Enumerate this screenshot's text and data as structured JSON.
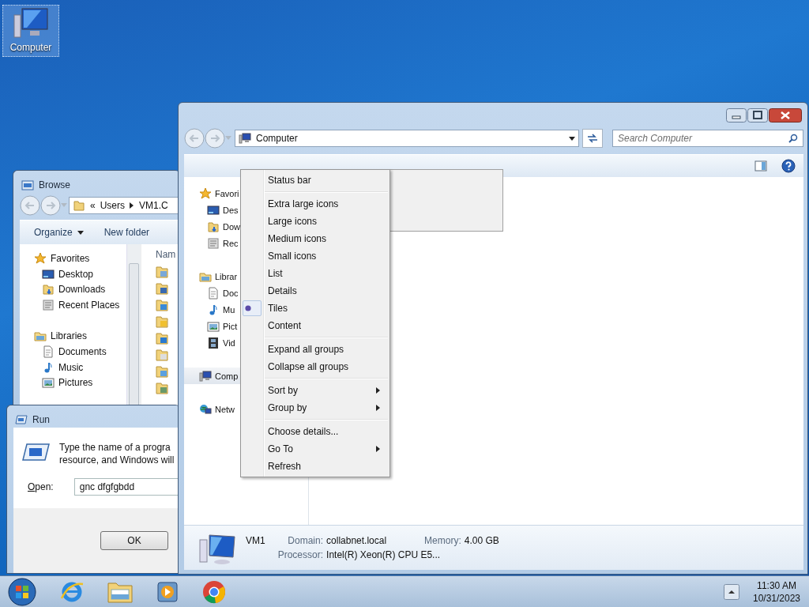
{
  "desktop": {
    "icons": [
      {
        "label": "Computer",
        "selected": true
      }
    ]
  },
  "browse_window": {
    "title": "Browse",
    "address": {
      "overflow": "«",
      "crumbs": [
        "Users",
        "VM1.C"
      ]
    },
    "toolbar": [
      "Organize",
      "New folder"
    ],
    "column_header": "Nam",
    "nav": [
      {
        "label": "Favorites",
        "children": [
          {
            "label": "Desktop"
          },
          {
            "label": "Downloads"
          },
          {
            "label": "Recent Places"
          }
        ]
      },
      {
        "label": "Libraries",
        "children": [
          {
            "label": "Documents"
          },
          {
            "label": "Music"
          },
          {
            "label": "Pictures"
          }
        ]
      }
    ]
  },
  "run_dialog": {
    "title": "Run",
    "message_lines": [
      "Type the name of a progra",
      "resource, and Windows will"
    ],
    "open_label": "Open:",
    "value": "gnc dfgfgbdd",
    "buttons": [
      "OK"
    ]
  },
  "explorer_window": {
    "address": "Computer",
    "search": {
      "placeholder": "Search Computer"
    },
    "nav": [
      {
        "label": "Favori",
        "selected": false,
        "children": [
          {
            "label": "Des",
            "selected": false
          },
          {
            "label": "Dow",
            "selected": false
          },
          {
            "label": "Rec",
            "selected": false
          }
        ]
      },
      {
        "label": "Librar",
        "selected": false,
        "children": [
          {
            "label": "Doc",
            "selected": false
          },
          {
            "label": "Mu",
            "selected": false
          },
          {
            "label": "Pict",
            "selected": false
          },
          {
            "label": "Vid",
            "selected": false
          }
        ]
      },
      {
        "label": "Comp",
        "selected": true
      },
      {
        "label": "Netw",
        "selected": false
      }
    ],
    "details": {
      "name": "VM1",
      "fields": [
        {
          "label": "Domain:",
          "value": "collabnet.local"
        },
        {
          "label": "Memory:",
          "value": "4.00 GB"
        },
        {
          "label": "Processor:",
          "value": "Intel(R) Xeon(R) CPU E5..."
        }
      ]
    }
  },
  "context_menu": {
    "items": [
      {
        "kind": "command",
        "label": "Status bar"
      },
      {
        "kind": "separator"
      },
      {
        "kind": "radio",
        "label": "Extra large icons",
        "selected": false
      },
      {
        "kind": "radio",
        "label": "Large icons",
        "selected": false
      },
      {
        "kind": "radio",
        "label": "Medium icons",
        "selected": false
      },
      {
        "kind": "radio",
        "label": "Small icons",
        "selected": false
      },
      {
        "kind": "radio",
        "label": "List",
        "selected": false
      },
      {
        "kind": "radio",
        "label": "Details",
        "selected": false
      },
      {
        "kind": "radio",
        "label": "Tiles",
        "selected": true
      },
      {
        "kind": "radio",
        "label": "Content",
        "selected": false
      },
      {
        "kind": "separator"
      },
      {
        "kind": "command",
        "label": "Expand all groups"
      },
      {
        "kind": "command",
        "label": "Collapse all groups"
      },
      {
        "kind": "separator"
      },
      {
        "kind": "submenu",
        "label": "Sort by"
      },
      {
        "kind": "submenu",
        "label": "Group by"
      },
      {
        "kind": "separator"
      },
      {
        "kind": "command",
        "label": "Choose details..."
      },
      {
        "kind": "submenu",
        "label": "Go To"
      },
      {
        "kind": "command",
        "label": "Refresh"
      }
    ]
  },
  "taskbar": {
    "time": "11:30 AM",
    "date": "10/31/2023"
  }
}
